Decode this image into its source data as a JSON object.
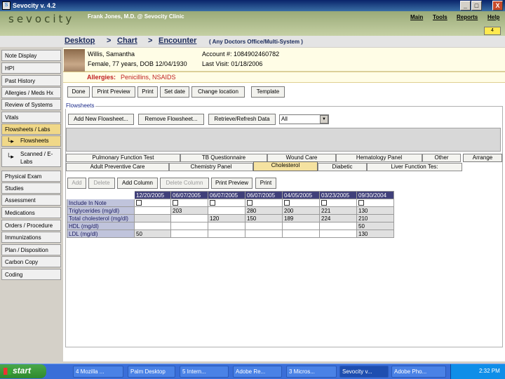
{
  "window": {
    "title": "Sevocity v. 4.2",
    "minimize": "_",
    "maximize": "□",
    "close": "X"
  },
  "header": {
    "logo": "sevocity",
    "user": "Frank Jones, M.D. @ Sevocity Clinic",
    "menu": [
      "Main",
      "Tools",
      "Reports",
      "Help"
    ],
    "badge": "4"
  },
  "breadcrumb": {
    "items": [
      "Desktop",
      "Chart",
      "Encounter"
    ],
    "sep": ">",
    "note": "( Any Doctors Office/Multi-System )"
  },
  "nav": {
    "items": [
      "Note Display",
      "HPI",
      "Past History",
      "Allergies / Meds Hx",
      "Review of Systems",
      "Vitals",
      "Flowsheets / Labs"
    ],
    "sub_items": [
      "Flowsheets",
      "Scanned / E-Labs"
    ],
    "items2": [
      "Physical Exam",
      "Studies",
      "Assessment",
      "Medications",
      "Orders / Procedure",
      "Immunizations",
      "Plan / Disposition",
      "Carbon Copy",
      "Coding"
    ]
  },
  "patient": {
    "name": "Willis, Samantha",
    "demo": "Female, 77 years, DOB 12/04/1930",
    "account": "Account #: 1084902460782",
    "last_visit": "Last Visit: 01/18/2006",
    "allergies_label": "Allergies:",
    "allergies": "Penicillins, NSAIDS"
  },
  "toolbar": [
    "Done",
    "Print Preview",
    "Print",
    "Set date",
    "Change location",
    "Template"
  ],
  "flowsheets": {
    "label": "Flowsheets",
    "buttons": [
      "Add New Flowsheet...",
      "Remove Flowsheet...",
      "Retrieve/Refresh Data"
    ],
    "select_value": "All",
    "tabs_row1": [
      "Pulmonary Function Test",
      "TB Questionnaire",
      "Wound Care",
      "Hematology Panel",
      "Other",
      "Arrange"
    ],
    "tabs_row2": [
      "Adult Preventive Care",
      "Chemistry Panel",
      "Cholesterol",
      "Diabetic",
      "Liver Function Tes:"
    ],
    "grid_buttons": [
      "Add",
      "Delete",
      "Add Column",
      "Delete Column",
      "Print Preview",
      "Print"
    ],
    "dates": [
      "12/20/2005",
      "06/07/2005",
      "06/07/2005",
      "06/07/2005",
      "04/05/2005",
      "03/23/2005",
      "09/30/2004"
    ],
    "rows": [
      {
        "label": "Include In Note",
        "values": [
          "",
          "",
          "",
          "",
          "",
          "",
          ""
        ]
      },
      {
        "label": "Triglycerides (mg/dl)",
        "values": [
          "",
          "203",
          "",
          "280",
          "200",
          "221",
          "130"
        ]
      },
      {
        "label": "Total cholesterol (mg/dl)",
        "values": [
          "",
          "",
          "120",
          "150",
          "189",
          "224",
          "210"
        ]
      },
      {
        "label": "HDL (mg/dl)",
        "values": [
          "",
          "",
          "",
          "",
          "",
          "",
          "50"
        ]
      },
      {
        "label": "LDL (mg/dl)",
        "values": [
          "50",
          "",
          "",
          "",
          "",
          "",
          "130"
        ]
      }
    ]
  },
  "taskbar": {
    "start": "start",
    "items": [
      "4 Mozilla ...",
      "Palm Desktop",
      "5 Intern...",
      "Adobe Re...",
      "3 Micros...",
      "Sevocity v...",
      "Adobe Pho..."
    ],
    "clock": "2:32 PM"
  }
}
